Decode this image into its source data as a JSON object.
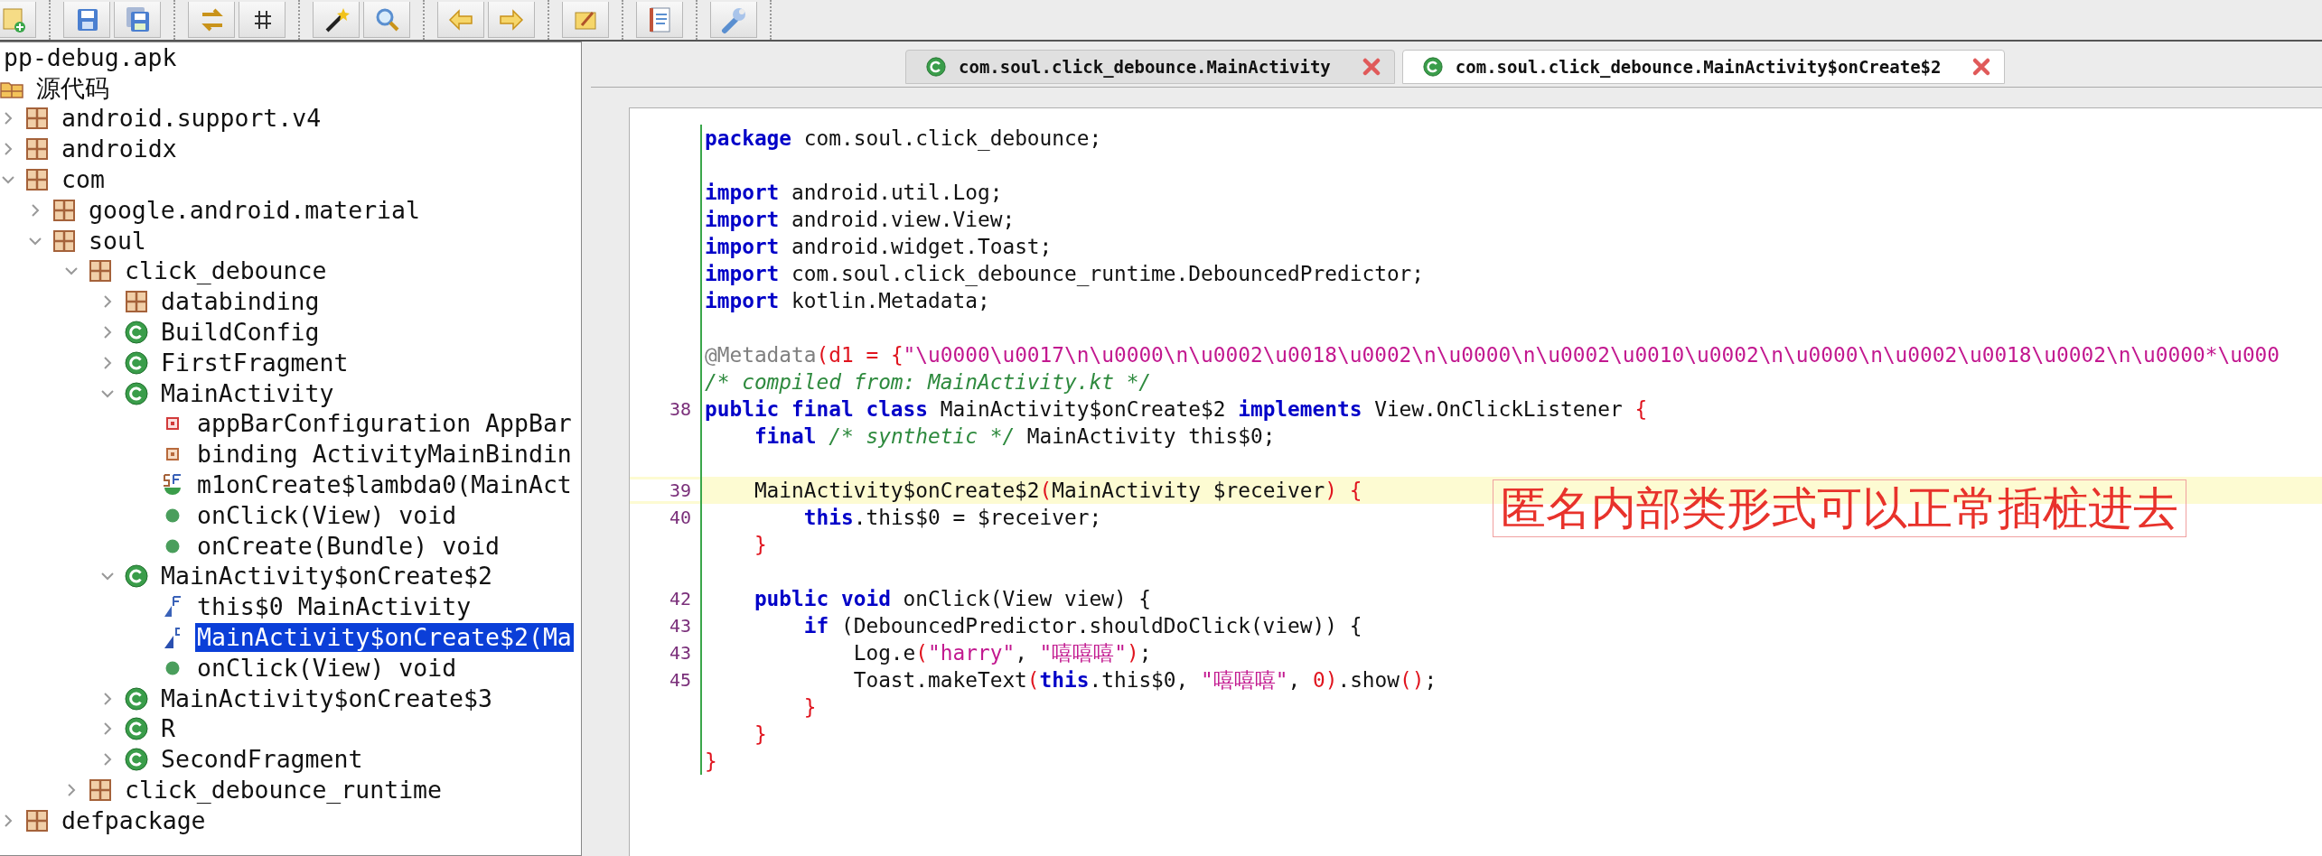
{
  "tree": [
    {
      "label": "pp-debug.apk",
      "kind": "apk",
      "selected": false,
      "children": [
        {
          "label": "源代码",
          "kind": "source",
          "selected": false,
          "children": [
            {
              "label": "android.support.v4",
              "kind": "package",
              "selected": false,
              "expanded": false
            },
            {
              "label": "androidx",
              "kind": "package",
              "selected": false,
              "expanded": false
            },
            {
              "label": "com",
              "kind": "package",
              "selected": false,
              "expanded": true,
              "children": [
                {
                  "label": "google.android.material",
                  "kind": "package",
                  "selected": false,
                  "expanded": false
                },
                {
                  "label": "soul",
                  "kind": "package",
                  "selected": false,
                  "expanded": true,
                  "children": [
                    {
                      "label": "click_debounce",
                      "kind": "package",
                      "selected": false,
                      "expanded": true,
                      "children": [
                        {
                          "label": "databinding",
                          "kind": "package",
                          "selected": false,
                          "expanded": false
                        },
                        {
                          "label": "BuildConfig",
                          "kind": "class",
                          "selected": false,
                          "expanded": false
                        },
                        {
                          "label": "FirstFragment",
                          "kind": "class",
                          "selected": false,
                          "expanded": false
                        },
                        {
                          "label": "MainActivity",
                          "kind": "class",
                          "selected": false,
                          "expanded": true,
                          "children": [
                            {
                              "label": "appBarConfiguration AppBar",
                              "kind": "private-field",
                              "selected": false
                            },
                            {
                              "label": "binding ActivityMainBindin",
                              "kind": "field",
                              "selected": false
                            },
                            {
                              "label": "m1onCreate$lambda0(MainAct",
                              "kind": "static-method",
                              "selected": false
                            },
                            {
                              "label": "onClick(View) void",
                              "kind": "method",
                              "selected": false
                            },
                            {
                              "label": "onCreate(Bundle) void",
                              "kind": "method",
                              "selected": false
                            }
                          ]
                        },
                        {
                          "label": "MainActivity$onCreate$2",
                          "kind": "class",
                          "selected": false,
                          "expanded": true,
                          "children": [
                            {
                              "label": "this$0 MainActivity",
                              "kind": "final-field",
                              "selected": false
                            },
                            {
                              "label": "MainActivity$onCreate$2(Ma",
                              "kind": "constructor",
                              "selected": true
                            },
                            {
                              "label": "onClick(View) void",
                              "kind": "method",
                              "selected": false
                            }
                          ]
                        },
                        {
                          "label": "MainActivity$onCreate$3",
                          "kind": "class",
                          "selected": false,
                          "expanded": false
                        },
                        {
                          "label": "R",
                          "kind": "class",
                          "selected": false,
                          "expanded": false
                        },
                        {
                          "label": "SecondFragment",
                          "kind": "class",
                          "selected": false,
                          "expanded": false
                        }
                      ]
                    },
                    {
                      "label": "click_debounce_runtime",
                      "kind": "package",
                      "selected": false,
                      "expanded": false
                    }
                  ]
                }
              ]
            },
            {
              "label": "defpackage",
              "kind": "package",
              "selected": false,
              "expanded": false
            }
          ]
        }
      ]
    }
  ],
  "tabs": [
    {
      "label": "com.soul.click_debounce.MainActivity",
      "selected": false
    },
    {
      "label": "com.soul.click_debounce.MainActivity$onCreate$2",
      "selected": true
    }
  ],
  "code": {
    "lines": [
      {
        "highlighted": false,
        "segments": [
          {
            "kind": "keyword",
            "text": "package"
          },
          {
            "kind": "plain",
            "text": " com.soul.click_debounce;"
          }
        ]
      },
      {
        "highlighted": false
      },
      {
        "highlighted": false,
        "segments": [
          {
            "kind": "keyword",
            "text": "import"
          },
          {
            "kind": "plain",
            "text": " android.util.Log;"
          }
        ]
      },
      {
        "highlighted": false,
        "segments": [
          {
            "kind": "keyword",
            "text": "import"
          },
          {
            "kind": "plain",
            "text": " android.view.View;"
          }
        ]
      },
      {
        "highlighted": false,
        "segments": [
          {
            "kind": "keyword",
            "text": "import"
          },
          {
            "kind": "plain",
            "text": " android.widget.Toast;"
          }
        ]
      },
      {
        "highlighted": false,
        "segments": [
          {
            "kind": "keyword",
            "text": "import"
          },
          {
            "kind": "plain",
            "text": " com.soul.click_debounce_runtime.DebouncedPredictor;"
          }
        ]
      },
      {
        "highlighted": false,
        "segments": [
          {
            "kind": "keyword",
            "text": "import"
          },
          {
            "kind": "plain",
            "text": " kotlin.Metadata;"
          }
        ]
      },
      {
        "highlighted": false
      },
      {
        "highlighted": false,
        "segments": [
          {
            "kind": "annotation",
            "text": "@Metadata"
          },
          {
            "kind": "punct",
            "text": "(d1 = {"
          },
          {
            "kind": "string",
            "text": "\"\\u0000\\u0017\\n\\u0000\\n\\u0002\\u0018\\u0002\\n\\u0000\\n\\u0002\\u0010\\u0002\\n\\u0000\\n\\u0002\\u0018\\u0002\\n\\u0000*\\u000"
          }
        ]
      },
      {
        "highlighted": false,
        "segments": [
          {
            "kind": "comment",
            "text": "/* compiled from: MainActivity.kt */"
          }
        ]
      },
      {
        "number": "38",
        "highlighted": false,
        "segments": [
          {
            "kind": "keyword",
            "text": "public final class"
          },
          {
            "kind": "plain",
            "text": " MainActivity$onCreate$2 "
          },
          {
            "kind": "keyword",
            "text": "implements"
          },
          {
            "kind": "plain",
            "text": " View.OnClickListener "
          },
          {
            "kind": "punct",
            "text": "{"
          }
        ]
      },
      {
        "highlighted": false,
        "segments": [
          {
            "kind": "keyword",
            "text": "    final"
          },
          {
            "kind": "comment",
            "text": " /* synthetic */"
          },
          {
            "kind": "plain",
            "text": " MainActivity this$0;"
          }
        ]
      },
      {
        "highlighted": false
      },
      {
        "number": "39",
        "highlighted": true,
        "segments": [
          {
            "kind": "plain",
            "text": "    MainActivity$onCreate$2"
          },
          {
            "kind": "punct",
            "text": "("
          },
          {
            "kind": "plain",
            "text": "MainActivity $receiver"
          },
          {
            "kind": "punct",
            "text": ")"
          },
          {
            "kind": "punct",
            "text": " {"
          }
        ]
      },
      {
        "number": "40",
        "highlighted": false,
        "segments": [
          {
            "kind": "keyword",
            "text": "        this"
          },
          {
            "kind": "plain",
            "text": ".this$0 = $receiver;"
          }
        ]
      },
      {
        "highlighted": false,
        "segments": [
          {
            "kind": "punct",
            "text": "    }"
          }
        ]
      },
      {
        "highlighted": false
      },
      {
        "number": "42",
        "highlighted": false,
        "segments": [
          {
            "kind": "keyword",
            "text": "    public void"
          },
          {
            "kind": "plain",
            "text": " onClick(View view) {"
          }
        ]
      },
      {
        "number": "43",
        "highlighted": false,
        "segments": [
          {
            "kind": "keyword",
            "text": "        if"
          },
          {
            "kind": "plain",
            "text": " (DebouncedPredictor.shouldDoClick(view)) {"
          }
        ]
      },
      {
        "number": "43",
        "highlighted": false,
        "segments": [
          {
            "kind": "plain",
            "text": "            Log.e"
          },
          {
            "kind": "punct",
            "text": "("
          },
          {
            "kind": "string",
            "text": "\"harry\""
          },
          {
            "kind": "plain",
            "text": ", "
          },
          {
            "kind": "string",
            "text": "\"嘻嘻嘻\""
          },
          {
            "kind": "punct",
            "text": ")"
          },
          {
            "kind": "plain",
            "text": ";"
          }
        ]
      },
      {
        "number": "45",
        "highlighted": false,
        "segments": [
          {
            "kind": "plain",
            "text": "            Toast.makeText"
          },
          {
            "kind": "punct",
            "text": "("
          },
          {
            "kind": "keyword",
            "text": "this"
          },
          {
            "kind": "plain",
            "text": ".this$0, "
          },
          {
            "kind": "string",
            "text": "\"嘻嘻嘻\""
          },
          {
            "kind": "plain",
            "text": ", "
          },
          {
            "kind": "punct",
            "text": "0"
          },
          {
            "kind": "punct",
            "text": ")"
          },
          {
            "kind": "plain",
            "text": ".show"
          },
          {
            "kind": "punct",
            "text": "()"
          },
          {
            "kind": "plain",
            "text": ";"
          }
        ]
      },
      {
        "highlighted": false,
        "segments": [
          {
            "kind": "punct",
            "text": "        }"
          }
        ]
      },
      {
        "highlighted": false,
        "segments": [
          {
            "kind": "punct",
            "text": "    }"
          }
        ]
      },
      {
        "highlighted": false,
        "segments": [
          {
            "kind": "punct",
            "text": "}"
          }
        ]
      }
    ]
  },
  "annotation": {
    "text": "匿名内部类形式可以正常插桩进去"
  }
}
